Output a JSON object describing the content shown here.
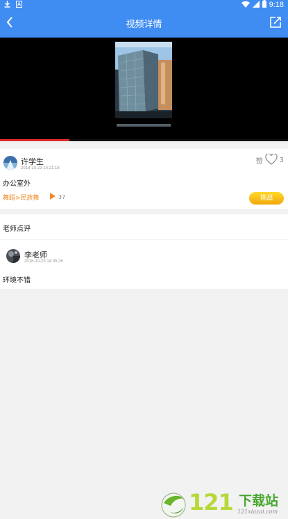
{
  "status_bar": {
    "time": "9:18",
    "icons": [
      "download-icon",
      "notification-icon",
      "wifi-icon",
      "signal-icon",
      "battery-icon"
    ]
  },
  "header": {
    "title": "视频详情",
    "back_icon": "back-arrow-icon",
    "share_icon": "share-icon"
  },
  "video": {
    "progress_percent": 24
  },
  "post": {
    "author": "许学生",
    "timestamp": "2018-10-23 14:21:18",
    "like_label": "赞",
    "like_count": "3",
    "text": "办公室外",
    "category": "舞蹈>民族舞",
    "play_count": "37",
    "challenge_label": "挑战"
  },
  "review": {
    "section_title": "老师点评",
    "teacher": "李老师",
    "timestamp": "2018-10-23 14:35:26",
    "comment": "环境不错"
  },
  "watermark": {
    "number": "121",
    "brand": "下载站",
    "url": "121xiazai.com"
  },
  "colors": {
    "primary": "#3f8cf2",
    "accent_orange": "#f08a24",
    "challenge_yellow": "#f7b91a",
    "progress_red": "#e02a2a"
  }
}
